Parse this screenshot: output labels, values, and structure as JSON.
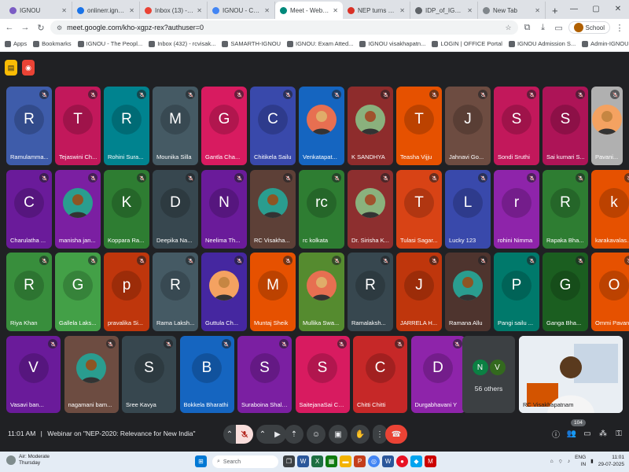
{
  "browser": {
    "tabs": [
      {
        "title": "IGNOU",
        "color": "#7b5cc4",
        "active": false
      },
      {
        "title": "onlinerr.ignou.ac.in",
        "color": "#1a73e8",
        "active": false
      },
      {
        "title": "Inbox (13) - rcvisakhapatn",
        "color": "#ea4335",
        "active": false
      },
      {
        "title": "IGNOU - Calendar - Tues",
        "color": "#4285f4",
        "active": false
      },
      {
        "title": "Meet - Webinar on \"N",
        "color": "#00897b",
        "active": true
      },
      {
        "title": "NEP turns 5: Gains, gaps",
        "color": "#d93025",
        "active": false
      },
      {
        "title": "IDP_of_IGNOU_2030.pdf",
        "color": "#5f6368",
        "active": false
      },
      {
        "title": "New Tab",
        "color": "#80868b",
        "active": false
      }
    ],
    "url": "meet.google.com/kho-xgpz-rex?authuser=0",
    "profile_label": "School",
    "bookmarks": [
      "Apps",
      "Bookmarks",
      "IGNOU - The Peopl...",
      "Inbox (432) - rcvisak...",
      "SAMARTH-IGNOU",
      "IGNOU: Exam Atted...",
      "IGNOU visakhapatn...",
      "LOGIN | OFFICE Portal",
      "IGNOU Admission S...",
      "Admin-IGNOU RC V...",
      "NEP - PDP | Home",
      "RTI Request & Ap..."
    ],
    "all_bookmarks": "All Bookmarks"
  },
  "meet": {
    "participants_row1": [
      {
        "name": "Ramulamma...",
        "letter": "R",
        "color": "#3e5caa"
      },
      {
        "name": "Tejaswini Ch...",
        "letter": "T",
        "color": "#c2185b"
      },
      {
        "name": "Rohini Sura...",
        "letter": "R",
        "color": "#00838f"
      },
      {
        "name": "Mounika Silla",
        "letter": "M",
        "color": "#455a64"
      },
      {
        "name": "Gantla Cha...",
        "letter": "G",
        "color": "#d81b60"
      },
      {
        "name": "Chitikela Sailu",
        "letter": "C",
        "color": "#3949ab"
      },
      {
        "name": "Venkatapat...",
        "letter": "",
        "color": "#1565c0"
      },
      {
        "name": "K SANDHYA",
        "letter": "",
        "color": "#8e2c2c"
      },
      {
        "name": "Teasha Vijju",
        "letter": "T",
        "color": "#e65100"
      },
      {
        "name": "Jahnavi Go...",
        "letter": "J",
        "color": "#6d4c41"
      },
      {
        "name": "Sondi Sruthi",
        "letter": "S",
        "color": "#c2185b"
      },
      {
        "name": "Sai kumari S...",
        "letter": "S",
        "color": "#ad1457"
      },
      {
        "name": "Pavani...",
        "letter": "",
        "color": "#b0b0b0"
      }
    ],
    "participants_row2": [
      {
        "name": "Charulatha ...",
        "letter": "C",
        "color": "#6a1b9a"
      },
      {
        "name": "manisha jan...",
        "letter": "",
        "color": "#7b1fa2"
      },
      {
        "name": "Koppara Ra...",
        "letter": "K",
        "color": "#2e7d32"
      },
      {
        "name": "Deepika Na...",
        "letter": "D",
        "color": "#37474f"
      },
      {
        "name": "Neelima Th...",
        "letter": "N",
        "color": "#6a1b9a"
      },
      {
        "name": "RC Visakha...",
        "letter": "",
        "color": "#5d4037"
      },
      {
        "name": "rc kolkata",
        "letter": "rc",
        "color": "#2e7d32"
      },
      {
        "name": "Dr. Sirisha K...",
        "letter": "",
        "color": "#8d2f2f"
      },
      {
        "name": "Tulasi Sagar...",
        "letter": "T",
        "color": "#d84315"
      },
      {
        "name": "Lucky 123",
        "letter": "L",
        "color": "#3949ab"
      },
      {
        "name": "rohini Nimma",
        "letter": "r",
        "color": "#8e24aa"
      },
      {
        "name": "Rapaka Bha...",
        "letter": "R",
        "color": "#2e7d32"
      },
      {
        "name": "karakavalas...",
        "letter": "k",
        "color": "#e65100"
      }
    ],
    "participants_row3": [
      {
        "name": "Riya Khan",
        "letter": "R",
        "color": "#388e3c"
      },
      {
        "name": "Gallela Laks...",
        "letter": "G",
        "color": "#43a047"
      },
      {
        "name": "pravalika Si...",
        "letter": "p",
        "color": "#bf360c"
      },
      {
        "name": "Rama Laksh...",
        "letter": "R",
        "color": "#455a64"
      },
      {
        "name": "Guttula Ch...",
        "letter": "",
        "color": "#4527a0"
      },
      {
        "name": "Muntaj Sheik",
        "letter": "M",
        "color": "#e65100"
      },
      {
        "name": "Mullika Swa...",
        "letter": "",
        "color": "#558b2f"
      },
      {
        "name": "Ramalaksh...",
        "letter": "R",
        "color": "#37474f"
      },
      {
        "name": "JARRELA H...",
        "letter": "J",
        "color": "#bf360c"
      },
      {
        "name": "Ramana Allu",
        "letter": "",
        "color": "#4e342e"
      },
      {
        "name": "Pangi sailu ...",
        "letter": "P",
        "color": "#00796b"
      },
      {
        "name": "Ganga Bha...",
        "letter": "G",
        "color": "#1b5e20"
      },
      {
        "name": "Ommi Pavani",
        "letter": "O",
        "color": "#e65100"
      }
    ],
    "participants_row4": [
      {
        "name": "Vasavi ban...",
        "letter": "V",
        "color": "#6a1b9a"
      },
      {
        "name": "nagamani bam...",
        "letter": "",
        "color": "#6d4c41"
      },
      {
        "name": "Sree Kavya",
        "letter": "S",
        "color": "#37474f"
      },
      {
        "name": "Bokkela Bharathi",
        "letter": "B",
        "color": "#1565c0"
      },
      {
        "name": "Suraboina Shale...",
        "letter": "S",
        "color": "#7b1fa2"
      },
      {
        "name": "SaitejanaSai Ch...",
        "letter": "S",
        "color": "#d81b60"
      },
      {
        "name": "Chitti Chitti",
        "letter": "C",
        "color": "#c62828"
      },
      {
        "name": "Durgabhavani Y",
        "letter": "D",
        "color": "#8e24aa"
      }
    ],
    "others": {
      "letters": [
        "N",
        "V"
      ],
      "label": "56 others"
    },
    "presenter_name": "RC Visakhapatnam",
    "meeting_time": "11:01 AM",
    "meeting_title": "Webinar on \"NEP-2020: Relevance for New India\"",
    "people_count": "104"
  },
  "taskbar": {
    "weather_line1": "Air: Moderate",
    "weather_line2": "Thursday",
    "search_placeholder": "Search",
    "lang_line1": "ENG",
    "lang_line2": "IN",
    "time": "11:01",
    "date": "29-07-2025"
  }
}
